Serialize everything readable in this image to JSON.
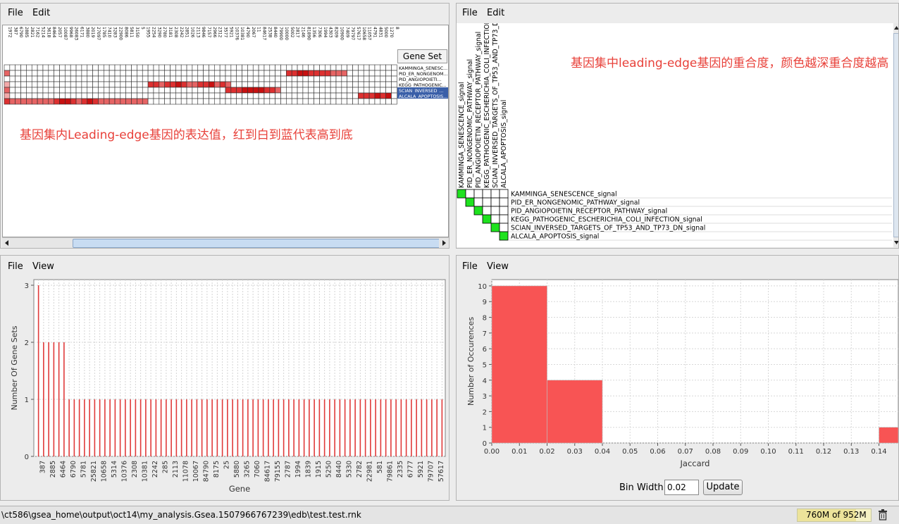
{
  "heatmap_panel": {
    "menu": [
      "File",
      "Edit"
    ],
    "gene_set_header": "Gene Set",
    "gene_columns": [
      "1972",
      "387",
      "6790",
      "2885",
      "2821",
      "7162",
      "5214",
      "3618",
      "8464",
      "2057",
      "10087",
      "9968",
      "26083",
      "6171",
      "3880",
      "2019",
      "27097",
      "1785",
      "7410",
      "3283",
      "22900",
      "8086",
      "5811",
      "3150",
      "5",
      "1955",
      "2254",
      "3290",
      "2780",
      "3181",
      "2308",
      "2242",
      "2851",
      "1026",
      "2113",
      "9846",
      "7157",
      "2966",
      "2312",
      "3577",
      "5921",
      "10376",
      "10381",
      "4790",
      "2067",
      "11",
      "84617",
      "2538",
      "8440",
      "79900",
      "10000",
      "5002",
      "2817",
      "2146",
      "81890",
      "1356",
      "7306",
      "1994",
      "4303",
      "8209",
      "10900",
      "7409",
      "79797",
      "57617",
      "10658",
      "11057",
      "4791",
      "4831",
      "5000",
      "1270",
      "8"
    ],
    "gene_sets": [
      {
        "label": "KAMMINGA_SENESC...",
        "selected": false
      },
      {
        "label": "PID_ER_NONGENOM...",
        "selected": false
      },
      {
        "label": "PID_ANGIOPOIETI...",
        "selected": false
      },
      {
        "label": "KEGG_PATHOGENIC...",
        "selected": false
      },
      {
        "label": "SCIAN_INVERSED_...",
        "selected": true
      },
      {
        "label": "ALCALA_APOPTOSIS...",
        "selected": true
      }
    ],
    "heat": [
      [
        0,
        0,
        0,
        0,
        0,
        0,
        0,
        0,
        0,
        0,
        0,
        0,
        0,
        0,
        0,
        0,
        0,
        0,
        0,
        0,
        0,
        0,
        0,
        0,
        0,
        0,
        0,
        0,
        0,
        0,
        0,
        0,
        0,
        0,
        0,
        0,
        0,
        0,
        0,
        0,
        0,
        0,
        0,
        0,
        0,
        0,
        0,
        0,
        0,
        0,
        0,
        0,
        0,
        0,
        0,
        0,
        0,
        0,
        0,
        0,
        0,
        0,
        0,
        0,
        0,
        0,
        0,
        0,
        0,
        0,
        0
      ],
      [
        2,
        0,
        0,
        0,
        0,
        0,
        0,
        0,
        0,
        0,
        0,
        0,
        0,
        0,
        0,
        0,
        0,
        0,
        0,
        0,
        0,
        0,
        0,
        0,
        0,
        0,
        0,
        0,
        0,
        0,
        0,
        0,
        0,
        0,
        0,
        0,
        0,
        0,
        0,
        0,
        0,
        0,
        0,
        0,
        0,
        0,
        0,
        0,
        0,
        0,
        0,
        3,
        3,
        4,
        4,
        3,
        3,
        3,
        3,
        2,
        2,
        2,
        0,
        0,
        0,
        0,
        0,
        0,
        0,
        0,
        0
      ],
      [
        0,
        0,
        0,
        0,
        0,
        0,
        0,
        0,
        0,
        0,
        0,
        0,
        0,
        0,
        0,
        0,
        0,
        0,
        0,
        0,
        0,
        0,
        0,
        0,
        0,
        0,
        0,
        0,
        0,
        0,
        0,
        0,
        0,
        0,
        0,
        0,
        0,
        0,
        0,
        0,
        0,
        0,
        0,
        0,
        0,
        0,
        0,
        0,
        0,
        0,
        0,
        0,
        0,
        0,
        0,
        0,
        0,
        0,
        0,
        0,
        0,
        0,
        0,
        0,
        0,
        0,
        0,
        0,
        0,
        0,
        0
      ],
      [
        1,
        0,
        0,
        0,
        0,
        0,
        0,
        0,
        0,
        0,
        0,
        0,
        0,
        0,
        0,
        0,
        0,
        0,
        0,
        0,
        0,
        0,
        0,
        0,
        0,
        0,
        3,
        3,
        2,
        3,
        3,
        4,
        3,
        2,
        2,
        3,
        3,
        4,
        2,
        3,
        2,
        0,
        0,
        0,
        0,
        0,
        0,
        0,
        0,
        0,
        0,
        0,
        0,
        0,
        0,
        0,
        0,
        0,
        0,
        0,
        0,
        0,
        0,
        0,
        0,
        0,
        0,
        0,
        0,
        0,
        0
      ],
      [
        2,
        0,
        0,
        0,
        0,
        0,
        0,
        0,
        0,
        0,
        0,
        0,
        0,
        0,
        0,
        0,
        0,
        0,
        0,
        0,
        0,
        0,
        0,
        0,
        0,
        0,
        0,
        0,
        0,
        0,
        0,
        0,
        0,
        0,
        0,
        0,
        0,
        0,
        0,
        0,
        3,
        3,
        3,
        4,
        4,
        4,
        4,
        3,
        3,
        2,
        0,
        0,
        0,
        0,
        0,
        0,
        0,
        0,
        0,
        0,
        0,
        0,
        0,
        0,
        0,
        0,
        0,
        0,
        0,
        0,
        0
      ],
      [
        1,
        0,
        0,
        0,
        0,
        0,
        0,
        0,
        0,
        0,
        0,
        0,
        0,
        0,
        0,
        0,
        0,
        0,
        0,
        0,
        0,
        0,
        0,
        0,
        0,
        0,
        0,
        0,
        0,
        0,
        0,
        0,
        0,
        0,
        0,
        0,
        0,
        0,
        0,
        0,
        0,
        0,
        0,
        0,
        0,
        0,
        0,
        0,
        0,
        0,
        0,
        0,
        0,
        0,
        0,
        0,
        0,
        0,
        0,
        0,
        0,
        0,
        0,
        0,
        3,
        3,
        3,
        4,
        3,
        4,
        0
      ],
      [
        3,
        2,
        2,
        2,
        2,
        2,
        2,
        2,
        2,
        3,
        4,
        4,
        3,
        2,
        3,
        4,
        3,
        2,
        2,
        2,
        2,
        2,
        2,
        2,
        2,
        2,
        0,
        0,
        0,
        0,
        0,
        0,
        0,
        0,
        0,
        0,
        0,
        0,
        0,
        0,
        0,
        0,
        0,
        0,
        0,
        0,
        0,
        0,
        0,
        0,
        0,
        0,
        0,
        0,
        0,
        0,
        0,
        0,
        0,
        0,
        0,
        0,
        0,
        0,
        0,
        0,
        0,
        0,
        0,
        0,
        0
      ]
    ],
    "annotation": "基因集内Leading-edge基因的表达值，红到白到蓝代表高到底"
  },
  "overlap_panel": {
    "menu": [
      "File",
      "Edit"
    ],
    "col_headers": [
      "KAMMINGA_SENESCENCE_signal",
      "PID_ER_NONGENOMIC_PATHWAY_signal",
      "PID_ANGIOPOIETIN_RECEPTOR_PATHWAY_signal",
      "KEGG_PATHOGENIC_ESCHERICHIA_COLI_INFECTION_signal",
      "SCIAN_INVERSED_TARGETS_OF_TP53_AND_TP73_DN_signal",
      "ALCALA_APOPTOSIS_signal"
    ],
    "row_labels": [
      "KAMMINGA_SENESCENCE_signal",
      "PID_ER_NONGENOMIC_PATHWAY_signal",
      "PID_ANGIOPOIETIN_RECEPTOR_PATHWAY_signal",
      "KEGG_PATHOGENIC_ESCHERICHIA_COLI_INFECTION_signal",
      "SCIAN_INVERSED_TARGETS_OF_TP53_AND_TP73_DN_signal",
      "ALCALA_APOPTOSIS_signal"
    ],
    "diag_color": "#1ee21e",
    "annotation": "基因集中leading-edge基因的重合度，颜色越深重合度越高"
  },
  "bar_panel": {
    "menu": [
      "File",
      "View"
    ],
    "chart_data": {
      "type": "bar",
      "xlabel": "Gene",
      "ylabel": "Number Of Gene Sets",
      "ylim": [
        0,
        3
      ],
      "yticks": [
        0,
        1,
        2,
        3
      ],
      "tick_labels": [
        "387",
        "2885",
        "6464",
        "6790",
        "5781",
        "25821",
        "10658",
        "5314",
        "10376",
        "2308",
        "10381",
        "2242",
        "285",
        "2113",
        "11078",
        "10067",
        "84790",
        "8175",
        "25",
        "5880",
        "3265",
        "7060",
        "84617",
        "79155",
        "2787",
        "1994",
        "1839",
        "1915",
        "5250",
        "8440",
        "5330",
        "2782",
        "22981",
        "581",
        "79861",
        "2335",
        "6777",
        "5921",
        "79707",
        "57617"
      ],
      "values": [
        3,
        2,
        2,
        2,
        2,
        2,
        1,
        1,
        1,
        1,
        1,
        1,
        1,
        1,
        1,
        1,
        1,
        1,
        1,
        1,
        1,
        1,
        1,
        1,
        1,
        1,
        1,
        1,
        1,
        1,
        1,
        1,
        1,
        1,
        1,
        1,
        1,
        1,
        1,
        1,
        1,
        1,
        1,
        1,
        1,
        1,
        1,
        1,
        1,
        1,
        1,
        1,
        1,
        1,
        1,
        1,
        1,
        1,
        1,
        1,
        1,
        1,
        1,
        1,
        1,
        1,
        1,
        1,
        1,
        1,
        1,
        1,
        1,
        1,
        1,
        1,
        1,
        1,
        1,
        1
      ]
    }
  },
  "hist_panel": {
    "menu": [
      "File",
      "View"
    ],
    "chart_data": {
      "type": "bar",
      "xlabel": "Jaccard",
      "ylabel": "Number of Occurences",
      "xlim": [
        0.0,
        0.147
      ],
      "ylim": [
        0,
        10.4
      ],
      "xticks": [
        "0.00",
        "0.01",
        "0.02",
        "0.03",
        "0.04",
        "0.05",
        "0.06",
        "0.07",
        "0.08",
        "0.09",
        "0.10",
        "0.11",
        "0.12",
        "0.13",
        "0.14"
      ],
      "yticks": [
        0,
        1,
        2,
        3,
        4,
        5,
        6,
        7,
        8,
        9,
        10
      ],
      "bins": [
        {
          "x0": 0.0,
          "x1": 0.02,
          "count": 10
        },
        {
          "x0": 0.02,
          "x1": 0.04,
          "count": 4
        },
        {
          "x0": 0.14,
          "x1": 0.16,
          "count": 1
        }
      ]
    },
    "bin_width_label": "Bin Width:",
    "bin_width_value": "0.02",
    "update_label": "Update"
  },
  "status": {
    "path": "\\ct586\\gsea_home\\output\\oct14\\my_analysis.Gsea.1507966767239\\edb\\test.test.rnk",
    "memory": "760M of 952M"
  },
  "colors": {
    "bar_red": "#e03a3a",
    "hist_red": "#f85454",
    "annot_red": "#e8413a",
    "diag_green": "#1ee21e"
  }
}
